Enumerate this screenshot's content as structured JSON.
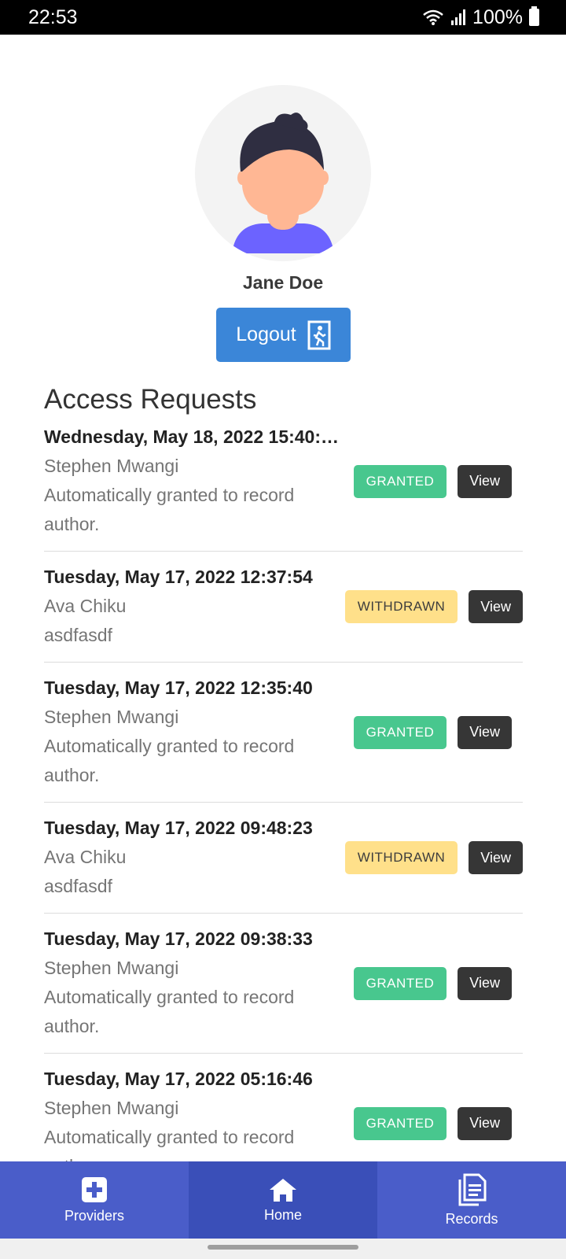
{
  "status_bar": {
    "time": "22:53",
    "battery": "100%"
  },
  "profile": {
    "name": "Jane Doe",
    "logout_label": "Logout"
  },
  "access_requests": {
    "title": "Access Requests",
    "items": [
      {
        "date": "Wednesday, May 18, 2022 15:40:…",
        "person": "Stephen Mwangi",
        "note": "Automatically granted to record author.",
        "status": "GRANTED",
        "view": "View"
      },
      {
        "date": "Tuesday, May 17, 2022 12:37:54",
        "person": "Ava Chiku",
        "note": "asdfasdf",
        "status": "WITHDRAWN",
        "view": "View"
      },
      {
        "date": "Tuesday, May 17, 2022 12:35:40",
        "person": "Stephen Mwangi",
        "note": "Automatically granted to record author.",
        "status": "GRANTED",
        "view": "View"
      },
      {
        "date": "Tuesday, May 17, 2022 09:48:23",
        "person": "Ava Chiku",
        "note": "asdfasdf",
        "status": "WITHDRAWN",
        "view": "View"
      },
      {
        "date": "Tuesday, May 17, 2022 09:38:33",
        "person": "Stephen Mwangi",
        "note": "Automatically granted to record author.",
        "status": "GRANTED",
        "view": "View"
      },
      {
        "date": "Tuesday, May 17, 2022 05:16:46",
        "person": "Stephen Mwangi",
        "note": "Automatically granted to record author.",
        "status": "GRANTED",
        "view": "View"
      }
    ]
  },
  "bottom_nav": {
    "providers": "Providers",
    "home": "Home",
    "records": "Records"
  },
  "colors": {
    "primary_blue": "#3b86d8",
    "nav_blue": "#4a5dc9",
    "granted_green": "#48c78e",
    "withdrawn_yellow": "#ffe08a",
    "dark_button": "#363636"
  }
}
